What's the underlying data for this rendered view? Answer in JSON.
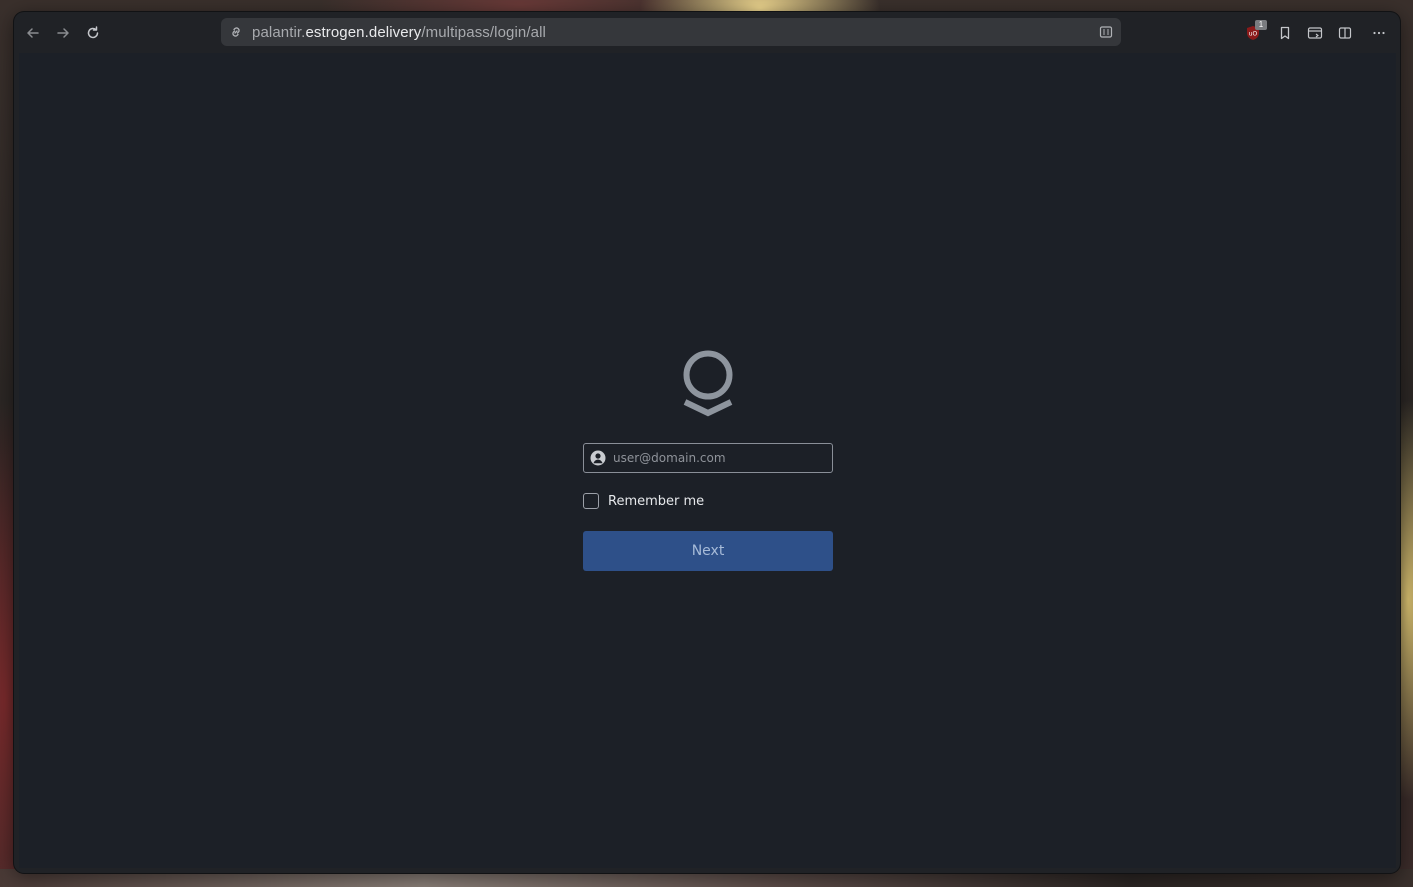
{
  "browser": {
    "url": {
      "prefix": "palantir.",
      "domain": "estrogen.delivery",
      "path": "/multipass/login/all"
    },
    "nav": [
      "back-icon",
      "forward-icon",
      "reload-icon"
    ],
    "extensions": {
      "ublock_badge": "1",
      "icons": [
        "ublock-shield-icon",
        "bookmark-icon",
        "tab-switch-icon",
        "sidebar-icon",
        "more-icon"
      ]
    }
  },
  "login": {
    "email_placeholder": "user@domain.com",
    "remember_label": "Remember me",
    "remember_checked": false,
    "next_label": "Next"
  },
  "colors": {
    "page_bg": "#1c2027",
    "button_bg": "#2e5089",
    "button_text": "#a7bbd8",
    "logo": "#8e959e"
  }
}
